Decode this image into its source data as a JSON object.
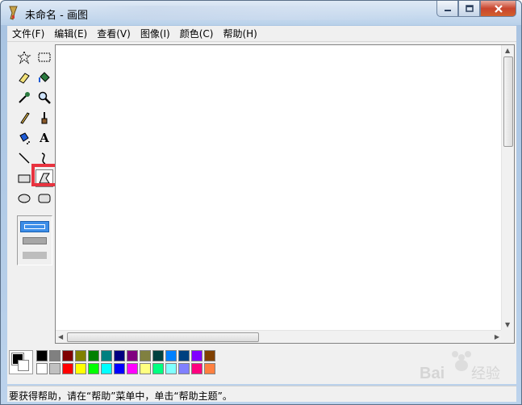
{
  "window": {
    "title": "未命名 - 画图"
  },
  "menu": [
    "文件(F)",
    "编辑(E)",
    "查看(V)",
    "图像(I)",
    "颜色(C)",
    "帮助(H)"
  ],
  "tools": [
    {
      "name": "free-form-select-tool",
      "icon": "star-select-icon"
    },
    {
      "name": "rect-select-tool",
      "icon": "rect-select-icon"
    },
    {
      "name": "eraser-tool",
      "icon": "eraser-icon"
    },
    {
      "name": "fill-tool",
      "icon": "bucket-icon"
    },
    {
      "name": "pick-color-tool",
      "icon": "eyedropper-icon"
    },
    {
      "name": "magnifier-tool",
      "icon": "magnifier-icon"
    },
    {
      "name": "pencil-tool",
      "icon": "pencil-icon"
    },
    {
      "name": "brush-tool",
      "icon": "brush-icon"
    },
    {
      "name": "airbrush-tool",
      "icon": "airbrush-icon"
    },
    {
      "name": "text-tool",
      "icon": "text-a-icon",
      "glyph": "A"
    },
    {
      "name": "line-tool",
      "icon": "line-icon"
    },
    {
      "name": "curve-tool",
      "icon": "curve-icon"
    },
    {
      "name": "rectangle-tool",
      "icon": "rectangle-icon"
    },
    {
      "name": "polygon-tool",
      "icon": "polygon-icon",
      "selected": true
    },
    {
      "name": "ellipse-tool",
      "icon": "ellipse-icon"
    },
    {
      "name": "rounded-rect-tool",
      "icon": "rounded-rect-icon"
    }
  ],
  "palette": {
    "top": [
      "#000000",
      "#808080",
      "#800000",
      "#808000",
      "#008000",
      "#008080",
      "#000080",
      "#800080",
      "#808040",
      "#004040",
      "#0080ff",
      "#004080",
      "#8000ff",
      "#804000"
    ],
    "bottom": [
      "#ffffff",
      "#c0c0c0",
      "#ff0000",
      "#ffff00",
      "#00ff00",
      "#00ffff",
      "#0000ff",
      "#ff00ff",
      "#ffff80",
      "#00ff80",
      "#80ffff",
      "#8080ff",
      "#ff0080",
      "#ff8040"
    ],
    "foreground": "#000000",
    "background": "#ffffff"
  },
  "status": {
    "text": "要获得帮助，请在“帮助”菜单中，单击“帮助主题”。"
  }
}
